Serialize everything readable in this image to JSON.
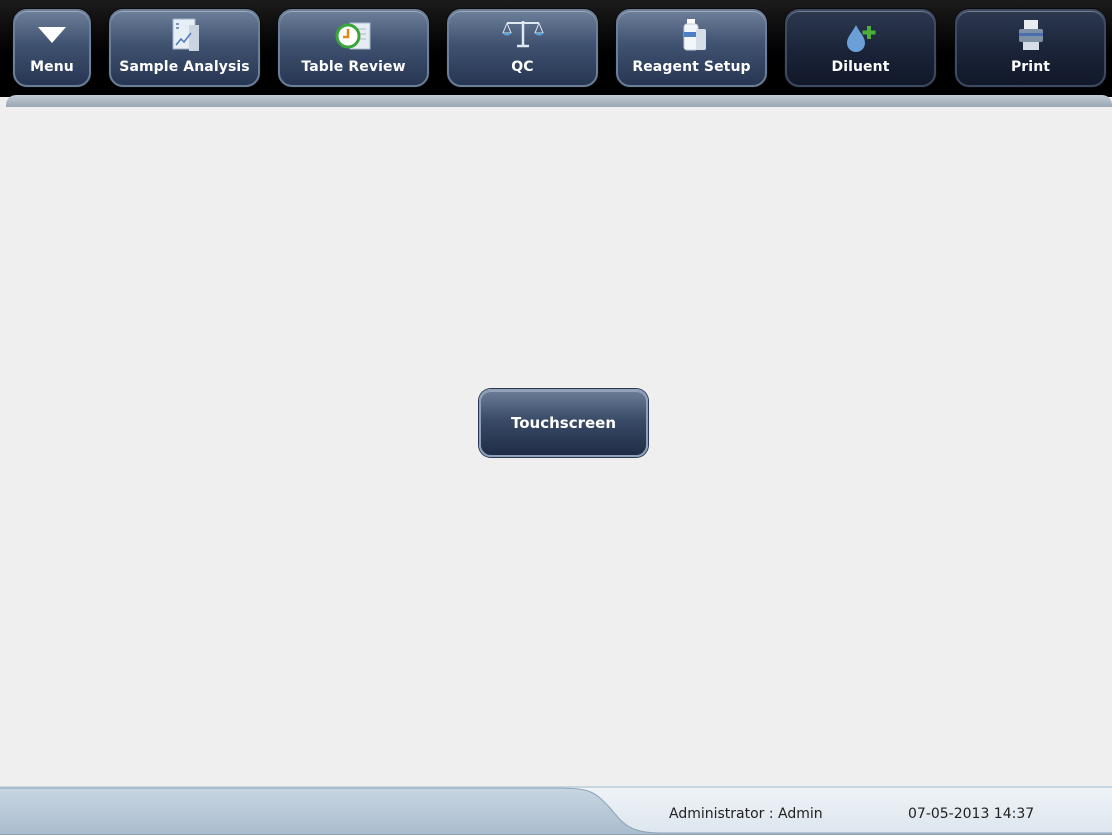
{
  "toolbar": {
    "menu": {
      "label": "Menu",
      "icon": "triangle-down-icon"
    },
    "sample_analysis": {
      "label": "Sample Analysis",
      "icon": "chart-document-icon"
    },
    "table_review": {
      "label": "Table Review",
      "icon": "clock-document-icon"
    },
    "qc": {
      "label": "QC",
      "icon": "balance-scale-icon"
    },
    "reagent_setup": {
      "label": "Reagent Setup",
      "icon": "reagent-bottle-icon"
    },
    "diluent": {
      "label": "Diluent",
      "icon": "drop-plus-icon"
    },
    "print": {
      "label": "Print",
      "icon": "printer-icon"
    }
  },
  "main": {
    "touchscreen_label": "Touchscreen"
  },
  "status": {
    "user": "Administrator : Admin",
    "datetime": "07-05-2013 14:37"
  },
  "colors": {
    "background": "#efefef",
    "toolbar": "#000000",
    "button_blue": "#3f5270",
    "status_bar": "#b9cad8",
    "status_panel": "#e6eef4"
  }
}
